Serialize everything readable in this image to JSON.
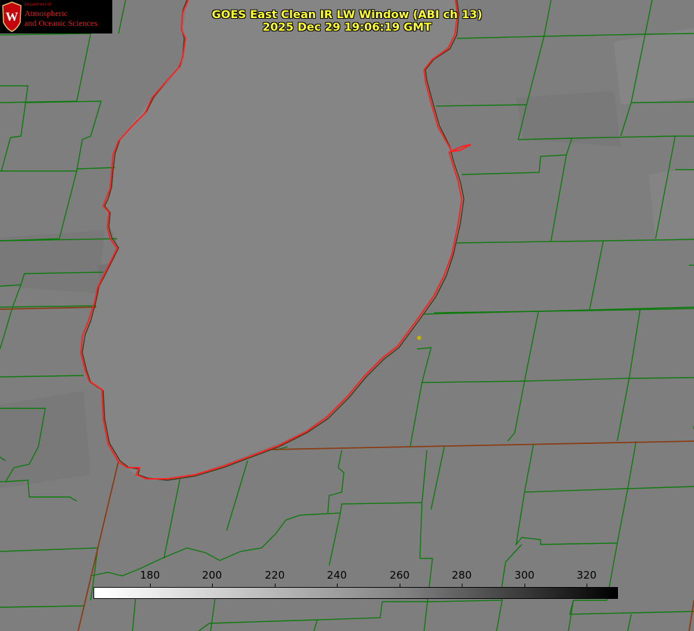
{
  "title": {
    "line1": "GOES East Clean IR LW Window (ABI ch 13)",
    "line2": "2025 Dec 29 19:06:19 GMT"
  },
  "logo": {
    "dept": "Department of",
    "line1": "Atmospheric",
    "line2": "and Oceanic Sciences",
    "seal_letter": "W"
  },
  "colorbar": {
    "labels": [
      "180",
      "200",
      "220",
      "240",
      "260",
      "280",
      "300",
      "320"
    ]
  },
  "colors": {
    "background": "#7e7e7e",
    "lake": "#858585",
    "county_lines": "#0b7a0b",
    "state_lines": "#8a3b12",
    "coastline": "#ff2020",
    "title": "#ffff33",
    "marker": "#c8b400"
  }
}
